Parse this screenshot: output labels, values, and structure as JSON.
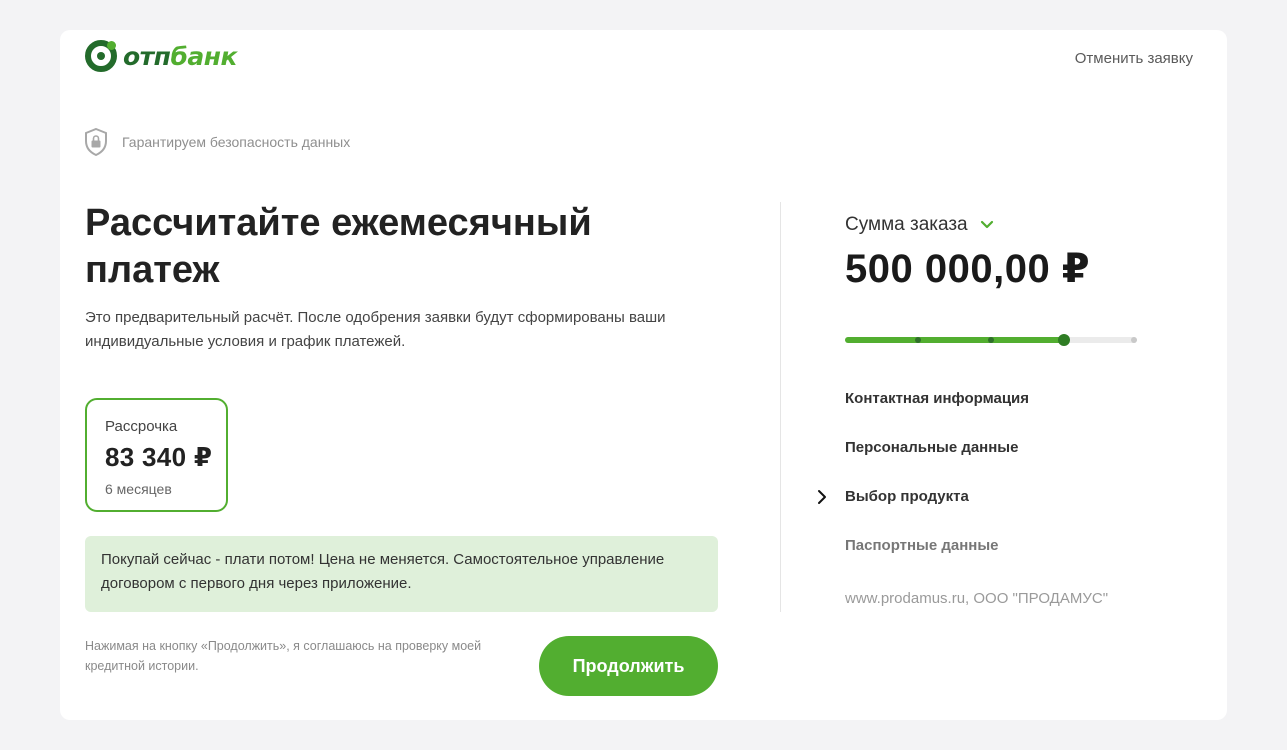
{
  "brand": {
    "logo_text_otp": "отп",
    "logo_text_bank": "банк",
    "accent_color": "#52ae30",
    "dark_green": "#236b2b"
  },
  "header": {
    "cancel_label": "Отменить заявку"
  },
  "security": {
    "icon": "shield-lock-icon",
    "text": "Гарантируем безопасность данных"
  },
  "main": {
    "title": "Рассчитайте ежемесячный платеж",
    "subtitle": "Это предварительный расчёт. После одобрения заявки будут сформированы ваши индивидуальные условия и график платежей."
  },
  "plan": {
    "name": "Рассрочка",
    "amount": "83 340 ₽",
    "term": "6 месяцев",
    "selected": true
  },
  "promo": {
    "text": "Покупай сейчас - плати потом! Цена не меняется. Самостоятельное управление договором с первого дня через приложение."
  },
  "consent": {
    "text": "Нажимая на кнопку «Продолжить», я соглашаюсь на проверку моей кредитной истории."
  },
  "actions": {
    "continue_label": "Продолжить"
  },
  "order": {
    "label": "Сумма заказа",
    "amount": "500 000,00 ₽",
    "toggle_icon": "chevron-down-icon"
  },
  "progress": {
    "total_steps": 5,
    "current_step": 4,
    "completed_steps": 3
  },
  "steps": [
    {
      "label": "Контактная информация",
      "state": "done"
    },
    {
      "label": "Персональные данные",
      "state": "done"
    },
    {
      "label": "Выбор продукта",
      "state": "current"
    },
    {
      "label": "Паспортные данные",
      "state": "todo"
    }
  ],
  "footer": {
    "text": "www.prodamus.ru, ООО \"ПРОДАМУС\""
  }
}
